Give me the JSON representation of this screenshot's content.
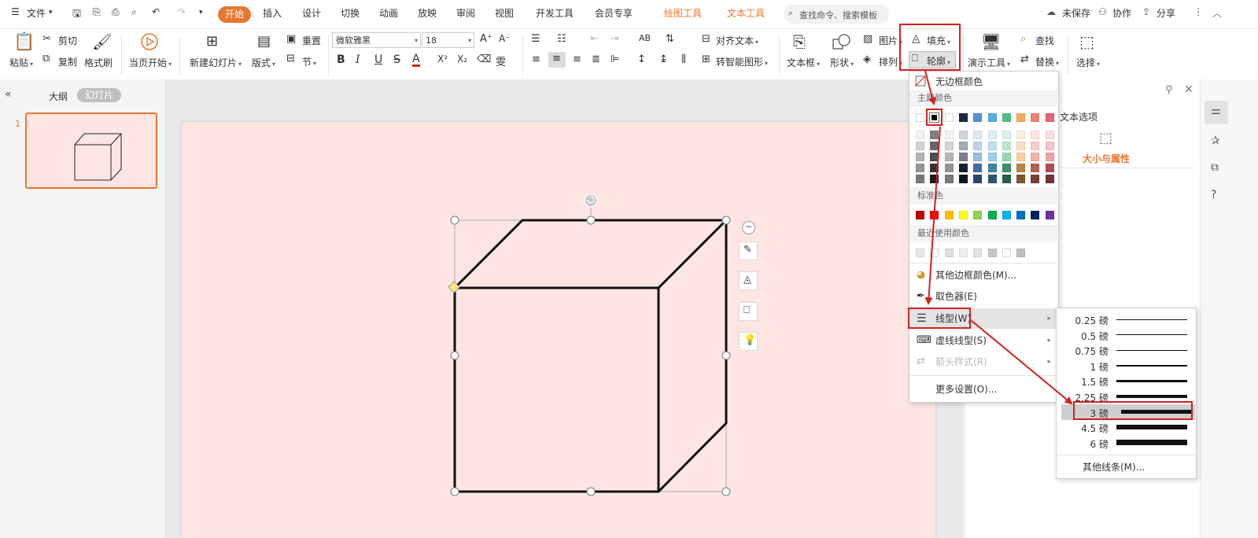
{
  "menubar": {
    "file_label": "文件",
    "tabs": [
      "开始",
      "插入",
      "设计",
      "切换",
      "动画",
      "放映",
      "审阅",
      "视图",
      "开发工具",
      "会员专享",
      "绘图工具",
      "文本工具"
    ],
    "search_placeholder": "查找命令、搜索模板",
    "unsaved": "未保存",
    "collab": "协作",
    "share": "分享"
  },
  "ribbon": {
    "paste": "粘贴",
    "cut": "剪切",
    "copy": "复制",
    "format_painter": "格式刷",
    "from_current": "当页开始",
    "new_slide": "新建幻灯片",
    "layout": "版式",
    "reset": "重置",
    "section": "节",
    "font_name": "微软雅黑",
    "font_size": "18",
    "align_text": "对齐文本",
    "smartart": "转智能图形",
    "textbox": "文本框",
    "shape": "形状",
    "arrange": "排列",
    "picture": "图片",
    "fill": "填充",
    "outline": "轮廓",
    "present_tools": "演示工具",
    "find": "查找",
    "replace": "替换",
    "select": "选择"
  },
  "leftpanel": {
    "outline_tab": "大纲",
    "slides_tab": "幻灯片",
    "slide_number": "1"
  },
  "rightpanel": {
    "text_options": "文本选项",
    "size_props": "大小与属性"
  },
  "outline_menu": {
    "no_border": "无边框颜色",
    "theme_colors": "主题颜色",
    "standard_colors": "标准色",
    "recent_colors": "最近使用颜色",
    "more_colors": "其他边框颜色(M)...",
    "eyedropper": "取色器(E)",
    "line_style": "线型(W)",
    "dash_style": "虚线线型(S)",
    "arrow_style": "箭头样式(R)",
    "more_settings": "更多设置(O)...",
    "theme_top_row": [
      "#ffffff",
      "#000000",
      "#ffffff",
      "#1f2a3c",
      "#5b8fd6",
      "#55aee0",
      "#4fc08d",
      "#f5ad5b",
      "#ee8270",
      "#e96373"
    ],
    "standard_row": [
      "#c00000",
      "#ff0000",
      "#ffc000",
      "#ffff00",
      "#92d050",
      "#00b050",
      "#00b0f0",
      "#0070c0",
      "#002060",
      "#7030a0"
    ],
    "recent_row": [
      "#e6e6e6",
      "#ffffff",
      "#e0e0e0",
      "#eeeeee",
      "#e3e3e3",
      "#c8c8c8",
      "#ffffff",
      "#bdbdbd"
    ]
  },
  "line_submenu": {
    "weights": [
      "0.25 磅",
      "0.5 磅",
      "0.75 磅",
      "1 磅",
      "1.5 磅",
      "2.25 磅",
      "3 磅",
      "4.5 磅",
      "6 磅"
    ],
    "selected": "3 磅",
    "more": "其他线条(M)..."
  },
  "colors": {
    "accent": "#e8772e",
    "highlight": "#d32020",
    "slide_bg": "#fde6e2"
  }
}
